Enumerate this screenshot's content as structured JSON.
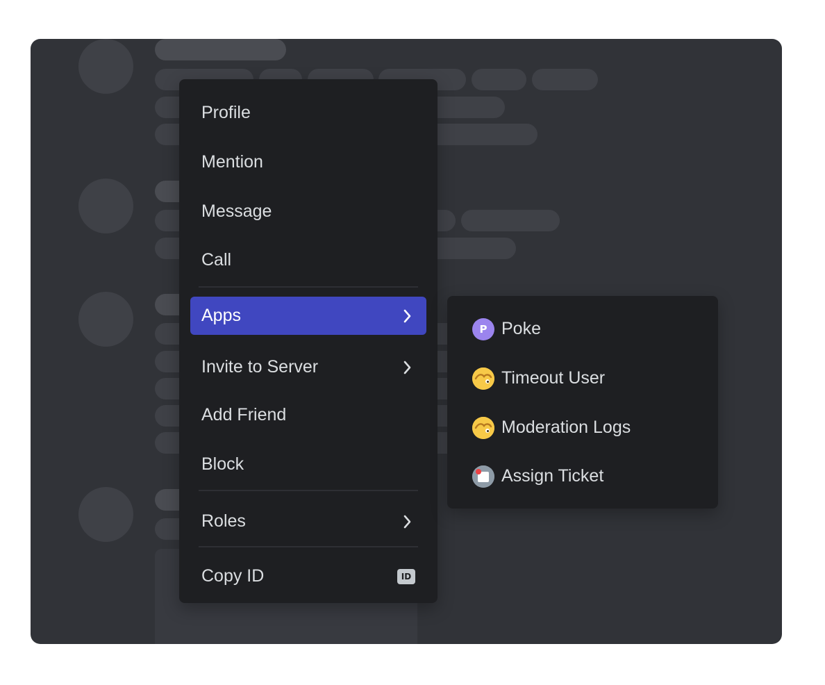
{
  "main_menu": {
    "items": [
      {
        "label": "Profile"
      },
      {
        "label": "Mention"
      },
      {
        "label": "Message"
      },
      {
        "label": "Call"
      },
      {
        "label": "Apps",
        "active": true,
        "has_submenu": true
      },
      {
        "label": "Invite to Server",
        "has_submenu": true
      },
      {
        "label": "Add Friend"
      },
      {
        "label": "Block"
      },
      {
        "label": "Roles",
        "has_submenu": true
      },
      {
        "label": "Copy ID",
        "badge": "ID"
      }
    ]
  },
  "sub_menu": {
    "items": [
      {
        "label": "Poke",
        "icon": "poke-app-icon",
        "icon_letter": "P"
      },
      {
        "label": "Timeout User",
        "icon": "timeout-app-icon"
      },
      {
        "label": "Moderation Logs",
        "icon": "moderation-app-icon"
      },
      {
        "label": "Assign Ticket",
        "icon": "ticket-app-icon"
      }
    ]
  },
  "colors": {
    "background": "#313338",
    "menu": "#1e1f22",
    "active": "#4047c0",
    "text": "#dbdee1",
    "poke_icon": "#9b84ee",
    "emoji_icon": "#f7c948"
  }
}
